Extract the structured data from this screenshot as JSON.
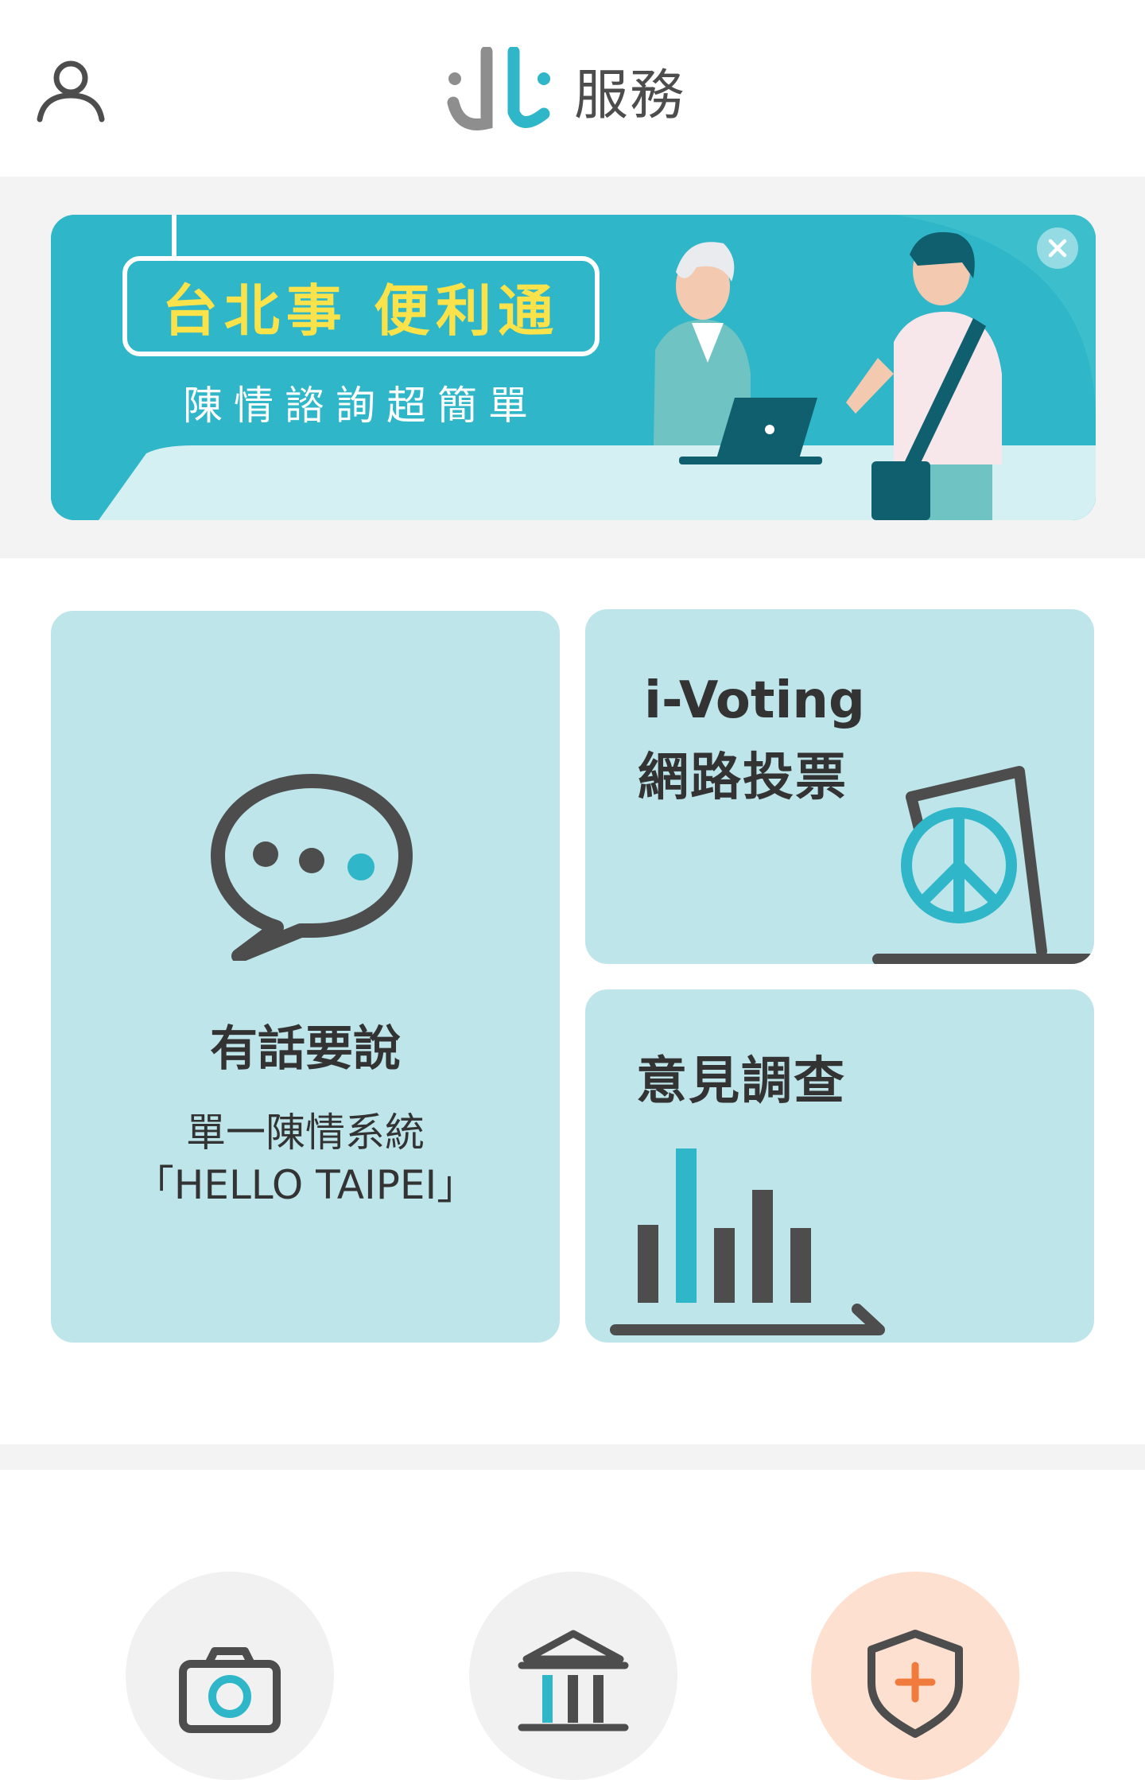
{
  "header": {
    "title": "服務",
    "user_icon": "user-icon",
    "logo_icon": "taipei-logo-icon"
  },
  "banner": {
    "title": "台北事 便利通",
    "subtitle": "陳情諮詢超簡單",
    "close_icon": "close-icon"
  },
  "cards": {
    "speak": {
      "title": "有話要說",
      "subtitle_line1": "單一陳情系統",
      "subtitle_line2": "「HELLO TAIPEI」",
      "icon": "chat-bubble-icon"
    },
    "vote": {
      "title_line1": "i-Voting",
      "title_line2": "網路投票",
      "icon": "ballot-box-icon"
    },
    "survey": {
      "title": "意見調查",
      "icon": "bar-chart-icon"
    }
  },
  "shortcuts": [
    {
      "icon": "camera-icon"
    },
    {
      "icon": "government-building-icon"
    },
    {
      "icon": "safety-shield-icon"
    }
  ],
  "colors": {
    "accent": "#2fb6c8",
    "card_bg": "#bde5ea",
    "banner_title": "#f9e24a",
    "safety_bg": "#fde0cf",
    "safety_plus": "#f07b3c",
    "icon_dark": "#4d4d4d"
  }
}
